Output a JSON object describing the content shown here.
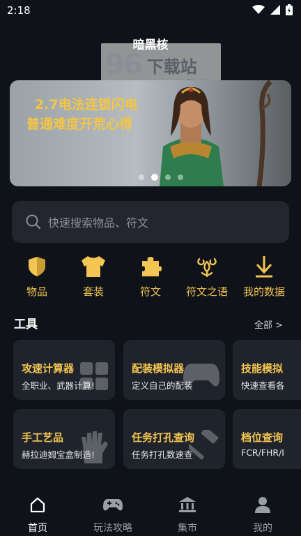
{
  "status": {
    "time": "2:18"
  },
  "app": {
    "title": "暗黑核"
  },
  "watermark": {
    "number": "96",
    "text": "下载站",
    "url": "www.96xz.com"
  },
  "banner": {
    "line1": "2.7电法连锁闪电",
    "line2": "普通难度开荒心得",
    "page_count": 4,
    "active_index": 1
  },
  "search": {
    "placeholder": "快速搜索物品、符文"
  },
  "categories": [
    {
      "label": "物品",
      "icon": "shield-icon"
    },
    {
      "label": "套装",
      "icon": "armor-icon"
    },
    {
      "label": "符文",
      "icon": "puzzle-icon"
    },
    {
      "label": "符文之语",
      "icon": "rune-icon"
    },
    {
      "label": "我的数据",
      "icon": "download-icon"
    }
  ],
  "tools": {
    "title": "工具",
    "all_label": "全部 >",
    "cards": [
      {
        "title": "攻速计算器",
        "subtitle": "全职业、武器计算!",
        "icon": "calculator-icon"
      },
      {
        "title": "配装模拟器",
        "subtitle": "定义自己的配装",
        "icon": "gamepad-icon"
      },
      {
        "title": "技能模拟",
        "subtitle": "快速查看各",
        "icon": "skill-icon"
      },
      {
        "title": "手工艺品",
        "subtitle": "赫拉迪姆宝盒制造!",
        "icon": "glove-icon"
      },
      {
        "title": "任务打孔查询",
        "subtitle": "任务打孔数速查",
        "icon": "hammer-icon"
      },
      {
        "title": "档位查询",
        "subtitle": "FCR/FHR/I",
        "icon": "chart-icon"
      }
    ]
  },
  "tabs": [
    {
      "label": "首页",
      "icon": "home-icon",
      "active": true
    },
    {
      "label": "玩法攻略",
      "icon": "gamepad-icon",
      "active": false
    },
    {
      "label": "集市",
      "icon": "bank-icon",
      "active": false
    },
    {
      "label": "我的",
      "icon": "user-icon",
      "active": false
    }
  ],
  "colors": {
    "background": "#0f1218",
    "accent": "#f3c552",
    "card": "#1f232b",
    "search": "#23262e"
  }
}
